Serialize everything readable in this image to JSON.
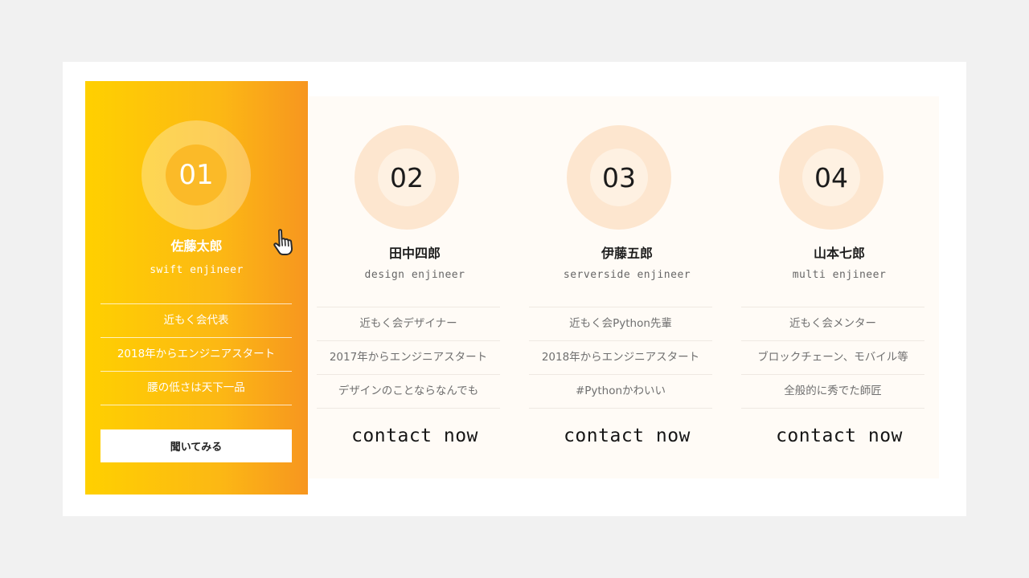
{
  "cards": [
    {
      "number": "01",
      "name": "佐藤太郎",
      "role": "swift enjineer",
      "features": [
        "近もく会代表",
        "2018年からエンジニアスタート",
        "腰の低さは天下一品"
      ],
      "cta": "聞いてみる"
    },
    {
      "number": "02",
      "name": "田中四郎",
      "role": "design enjineer",
      "features": [
        "近もく会デザイナー",
        "2017年からエンジニアスタート",
        "デザインのことならなんでも"
      ],
      "cta": "contact now"
    },
    {
      "number": "03",
      "name": "伊藤五郎",
      "role": "serverside enjineer",
      "features": [
        "近もく会Python先輩",
        "2018年からエンジニアスタート",
        "#Pythonかわいい"
      ],
      "cta": "contact now"
    },
    {
      "number": "04",
      "name": "山本七郎",
      "role": "multi enjineer",
      "features": [
        "近もく会メンター",
        "ブロックチェーン、モバイル等",
        "全般的に秀でた師匠"
      ],
      "cta": "contact now"
    }
  ],
  "colors": {
    "featured_gradient_start": "#ffd000",
    "featured_gradient_end": "#f7961f",
    "ring_light": "#fde6cf",
    "strip_background": "#fffbf6"
  },
  "icons": {
    "cursor": "hand-pointer-icon"
  }
}
